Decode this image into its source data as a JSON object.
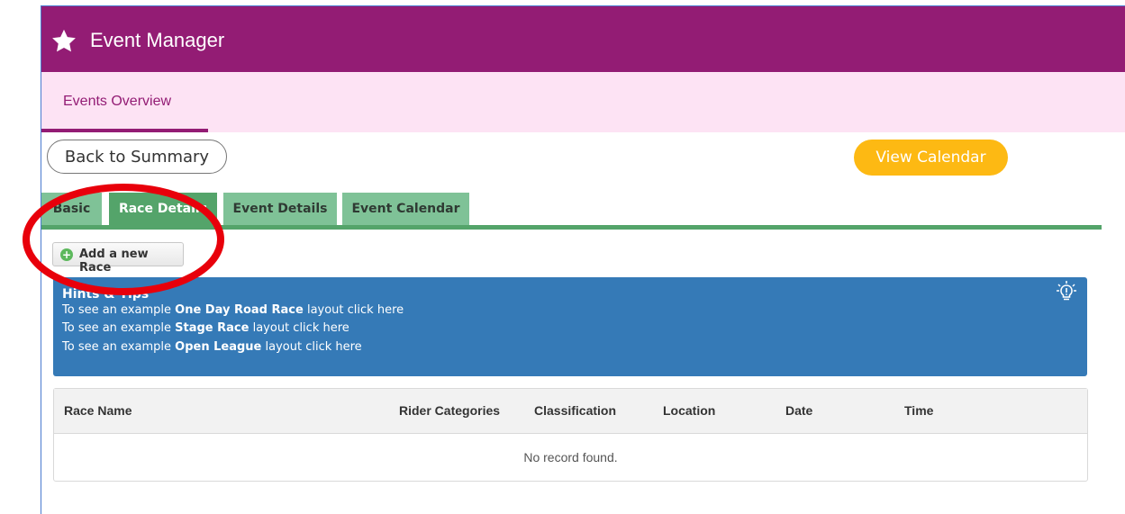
{
  "header": {
    "title": "Event Manager",
    "icon": "star-icon"
  },
  "subnav": {
    "active_tab": "Events Overview"
  },
  "actions": {
    "back_label": "Back to Summary",
    "calendar_label": "View Calendar"
  },
  "tabs": [
    {
      "label": "Basic",
      "active": false
    },
    {
      "label": "Race Details",
      "active": true
    },
    {
      "label": "Event Details",
      "active": false
    },
    {
      "label": "Event Calendar",
      "active": false
    }
  ],
  "add_race": {
    "label": "Add a new Race"
  },
  "hints": {
    "title": "Hints & Tips",
    "lines": [
      {
        "before": "To see an example ",
        "bold": "One Day Road Race",
        "after": " layout click here"
      },
      {
        "before": "To see an example ",
        "bold": "Stage Race",
        "after": " layout click here"
      },
      {
        "before": "To see an example ",
        "bold": "Open League",
        "after": " layout click here"
      }
    ]
  },
  "table": {
    "columns": [
      "Race Name",
      "Rider Categories",
      "Classification",
      "Location",
      "Date",
      "Time"
    ],
    "empty_message": "No record found."
  },
  "colors": {
    "header": "#931c74",
    "subnav": "#fde3f4",
    "tab_active": "#54a46a",
    "tab": "#7fc297",
    "calendar_button": "#fdb913",
    "hints": "#357ab7",
    "highlight": "#e8000b"
  }
}
